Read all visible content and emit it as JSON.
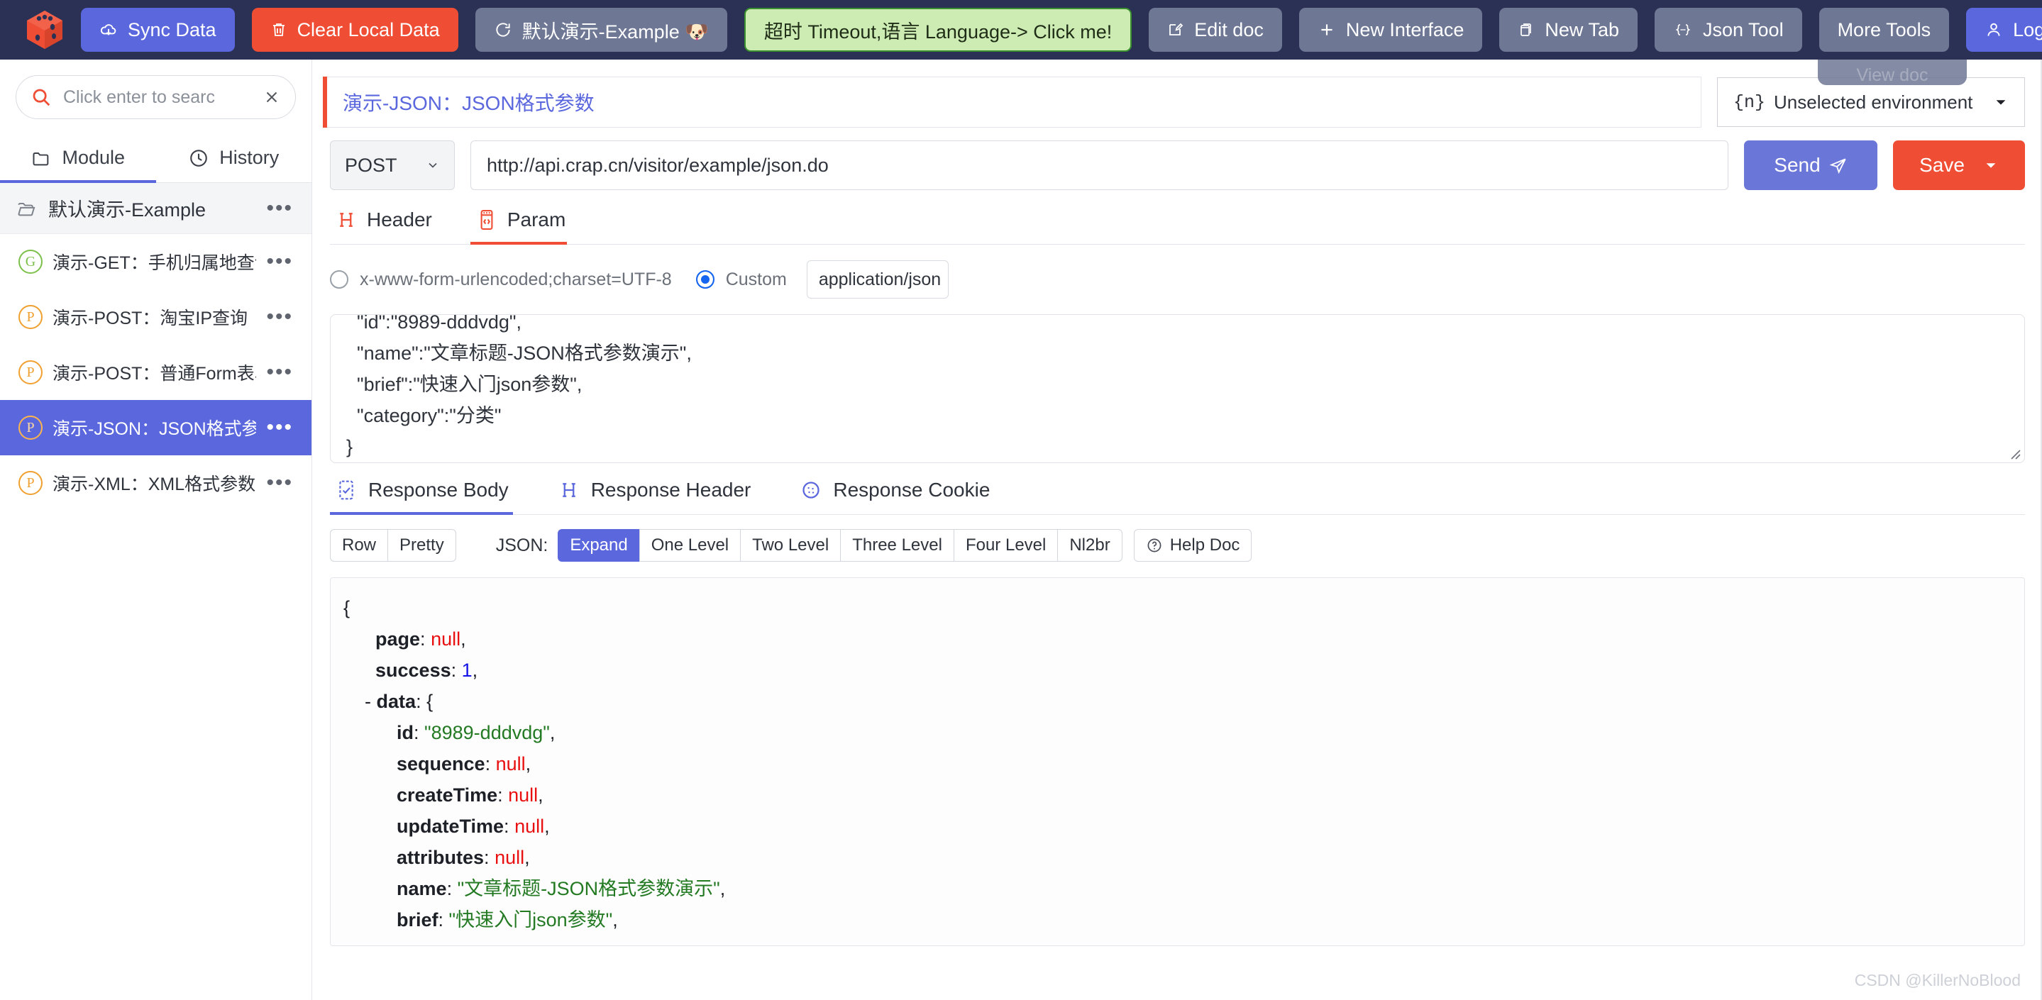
{
  "topbar": {
    "logo_icon": "dice-logo-icon",
    "buttons": [
      {
        "name": "sync-data",
        "label": "Sync Data",
        "icon": "cloud-upload-icon",
        "style": "blue"
      },
      {
        "name": "clear-local-data",
        "label": "Clear Local Data",
        "icon": "trash-icon",
        "style": "red"
      },
      {
        "name": "project-switch",
        "label": "默认演示-Example  🐶",
        "icon": "refresh-icon",
        "style": "grey"
      },
      {
        "name": "timeout-language",
        "label": "超时 Timeout,语言 Language-> Click me!",
        "icon": "",
        "style": "green"
      },
      {
        "name": "edit-doc",
        "label": "Edit doc",
        "icon": "edit-icon",
        "style": "grey"
      },
      {
        "name": "new-interface",
        "label": "New Interface",
        "icon": "plus-icon",
        "style": "grey"
      },
      {
        "name": "new-tab",
        "label": "New Tab",
        "icon": "tabs-icon",
        "style": "grey"
      },
      {
        "name": "json-tool",
        "label": "Json Tool",
        "icon": "braces-icon",
        "style": "grey"
      },
      {
        "name": "more-tools",
        "label": "More Tools",
        "icon": "",
        "style": "grey"
      },
      {
        "name": "login",
        "label": "Login",
        "icon": "user-icon",
        "style": "login"
      }
    ],
    "ghost_tab_label": "View doc"
  },
  "sidebar": {
    "search": {
      "placeholder": "Click enter to searc",
      "value": "",
      "search_icon": "search-icon",
      "clear_icon": "close-icon"
    },
    "tabs": [
      {
        "label": "Module",
        "icon": "folder-icon",
        "active": true
      },
      {
        "label": "History",
        "icon": "clock-icon",
        "active": false
      }
    ],
    "group": {
      "label": "默认演示-Example",
      "icon": "folder-open-icon",
      "menu": "•••"
    },
    "items": [
      {
        "method": "G",
        "label": "演示-GET：手机归属地查询",
        "selected": false
      },
      {
        "method": "P",
        "label": "演示-POST：淘宝IP查询",
        "selected": false
      },
      {
        "method": "P",
        "label": "演示-POST：普通Form表单",
        "selected": false
      },
      {
        "method": "P",
        "label": "演示-JSON：JSON格式参",
        "selected": true
      },
      {
        "method": "P",
        "label": "演示-XML：XML格式参数",
        "selected": false
      }
    ],
    "menu_dots": "•••"
  },
  "request": {
    "title": "演示-JSON：JSON格式参数",
    "environment": {
      "prefix": "{n}",
      "label": "Unselected environment",
      "chevron_icon": "chevron-down-icon"
    },
    "method": "POST",
    "url": "http://api.crap.cn/visitor/example/json.do",
    "send_label": "Send",
    "send_icon": "paper-plane-icon",
    "save_label": "Save",
    "save_chevron_icon": "chevron-down-icon",
    "tabs": [
      {
        "label": "Header",
        "icon": "header-h-icon",
        "active": false
      },
      {
        "label": "Param",
        "icon": "code-param-icon",
        "active": true
      }
    ],
    "content_type": {
      "option_form": "x-www-form-urlencoded;charset=UTF-8",
      "option_custom": "Custom",
      "selected": "Custom",
      "custom_value": "application/json"
    },
    "body": "  \"id\":\"8989-dddvdg\",\n  \"name\":\"文章标题-JSON格式参数演示\",\n  \"brief\":\"快速入门json参数\",\n  \"category\":\"分类\"\n}"
  },
  "response": {
    "tabs": [
      {
        "label": "Response Body",
        "icon": "checklist-icon",
        "active": true
      },
      {
        "label": "Response Header",
        "icon": "header-h-icon",
        "active": false
      },
      {
        "label": "Response Cookie",
        "icon": "cookie-icon",
        "active": false
      }
    ],
    "toolbar": {
      "view_group": [
        {
          "label": "Row",
          "active": false
        },
        {
          "label": "Pretty",
          "active": false
        }
      ],
      "json_label": "JSON:",
      "level_group": [
        {
          "label": "Expand",
          "active": true
        },
        {
          "label": "One Level",
          "active": false
        },
        {
          "label": "Two Level",
          "active": false
        },
        {
          "label": "Three Level",
          "active": false
        },
        {
          "label": "Four Level",
          "active": false
        },
        {
          "label": "Nl2br",
          "active": false
        }
      ],
      "help_doc": {
        "label": "Help Doc",
        "icon": "question-circle-icon"
      }
    },
    "json_lines": [
      {
        "indent": 0,
        "toggle": "",
        "key": "",
        "sep": "",
        "value": "{",
        "type": "plain"
      },
      {
        "indent": 1,
        "toggle": "",
        "key": "page",
        "sep": ": ",
        "value": "null",
        "type": "null",
        "comma": true
      },
      {
        "indent": 1,
        "toggle": "",
        "key": "success",
        "sep": ": ",
        "value": "1",
        "type": "num",
        "comma": true
      },
      {
        "indent": 1,
        "toggle": "-",
        "key": "data",
        "sep": ": ",
        "value": "{",
        "type": "plain"
      },
      {
        "indent": 2,
        "toggle": "",
        "key": "id",
        "sep": ": ",
        "value": "\"8989-dddvdg\"",
        "type": "str",
        "comma": true
      },
      {
        "indent": 2,
        "toggle": "",
        "key": "sequence",
        "sep": ": ",
        "value": "null",
        "type": "null",
        "comma": true
      },
      {
        "indent": 2,
        "toggle": "",
        "key": "createTime",
        "sep": ": ",
        "value": "null",
        "type": "null",
        "comma": true
      },
      {
        "indent": 2,
        "toggle": "",
        "key": "updateTime",
        "sep": ": ",
        "value": "null",
        "type": "null",
        "comma": true
      },
      {
        "indent": 2,
        "toggle": "",
        "key": "attributes",
        "sep": ": ",
        "value": "null",
        "type": "null",
        "comma": true
      },
      {
        "indent": 2,
        "toggle": "",
        "key": "name",
        "sep": ": ",
        "value": "\"文章标题-JSON格式参数演示\"",
        "type": "str",
        "comma": true
      },
      {
        "indent": 2,
        "toggle": "",
        "key": "brief",
        "sep": ": ",
        "value": "\"快速入门json参数\"",
        "type": "str",
        "comma": true
      }
    ]
  },
  "watermark": "CSDN @KillerNoBlood",
  "colors": {
    "topbar_bg": "#2b3155",
    "accent_blue": "#5b67dd",
    "accent_red": "#ef4e35",
    "green_btn": "#cdecb3",
    "selected_row": "#5b67dd"
  }
}
